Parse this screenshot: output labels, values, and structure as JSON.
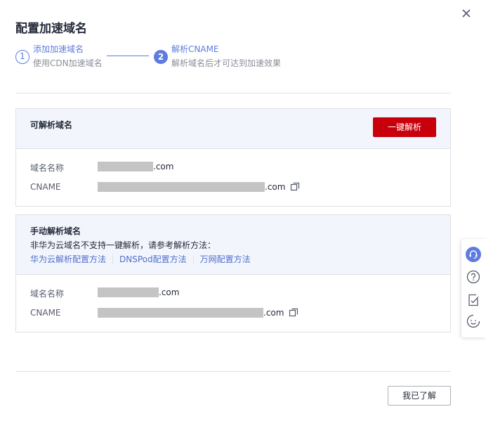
{
  "dialog": {
    "title": "配置加速域名",
    "close_icon": "close-icon",
    "steps": [
      {
        "number": "1",
        "name": "添加加速域名",
        "desc": "使用CDN加速域名"
      },
      {
        "number": "2",
        "name": "解析CNAME",
        "desc": "解析域名后才可达到加速效果"
      }
    ],
    "auto_panel": {
      "title": "可解析域名",
      "button": "一键解析",
      "rows": [
        {
          "label": "域名名称",
          "value_suffix": ".com"
        },
        {
          "label": "CNAME",
          "value_suffix": ".com"
        }
      ]
    },
    "manual_panel": {
      "title": "手动解析域名",
      "desc": "非华为云域名不支持一键解析，请参考解析方法：",
      "links": [
        "华为云解析配置方法",
        "DNSPod配置方法",
        "万网配置方法"
      ],
      "rows": [
        {
          "label": "域名名称",
          "value_suffix": ".com"
        },
        {
          "label": "CNAME",
          "value_suffix": ".com"
        }
      ]
    },
    "ok_button": "我已了解"
  },
  "float_bar": {
    "items": [
      "customer-service-icon",
      "help-icon",
      "feedback-icon",
      "smile-icon"
    ]
  },
  "colors": {
    "primary": "#c7000b",
    "accent": "#5e7ce0",
    "link": "#526ecc",
    "panel_head_bg": "#f2f5fc"
  }
}
